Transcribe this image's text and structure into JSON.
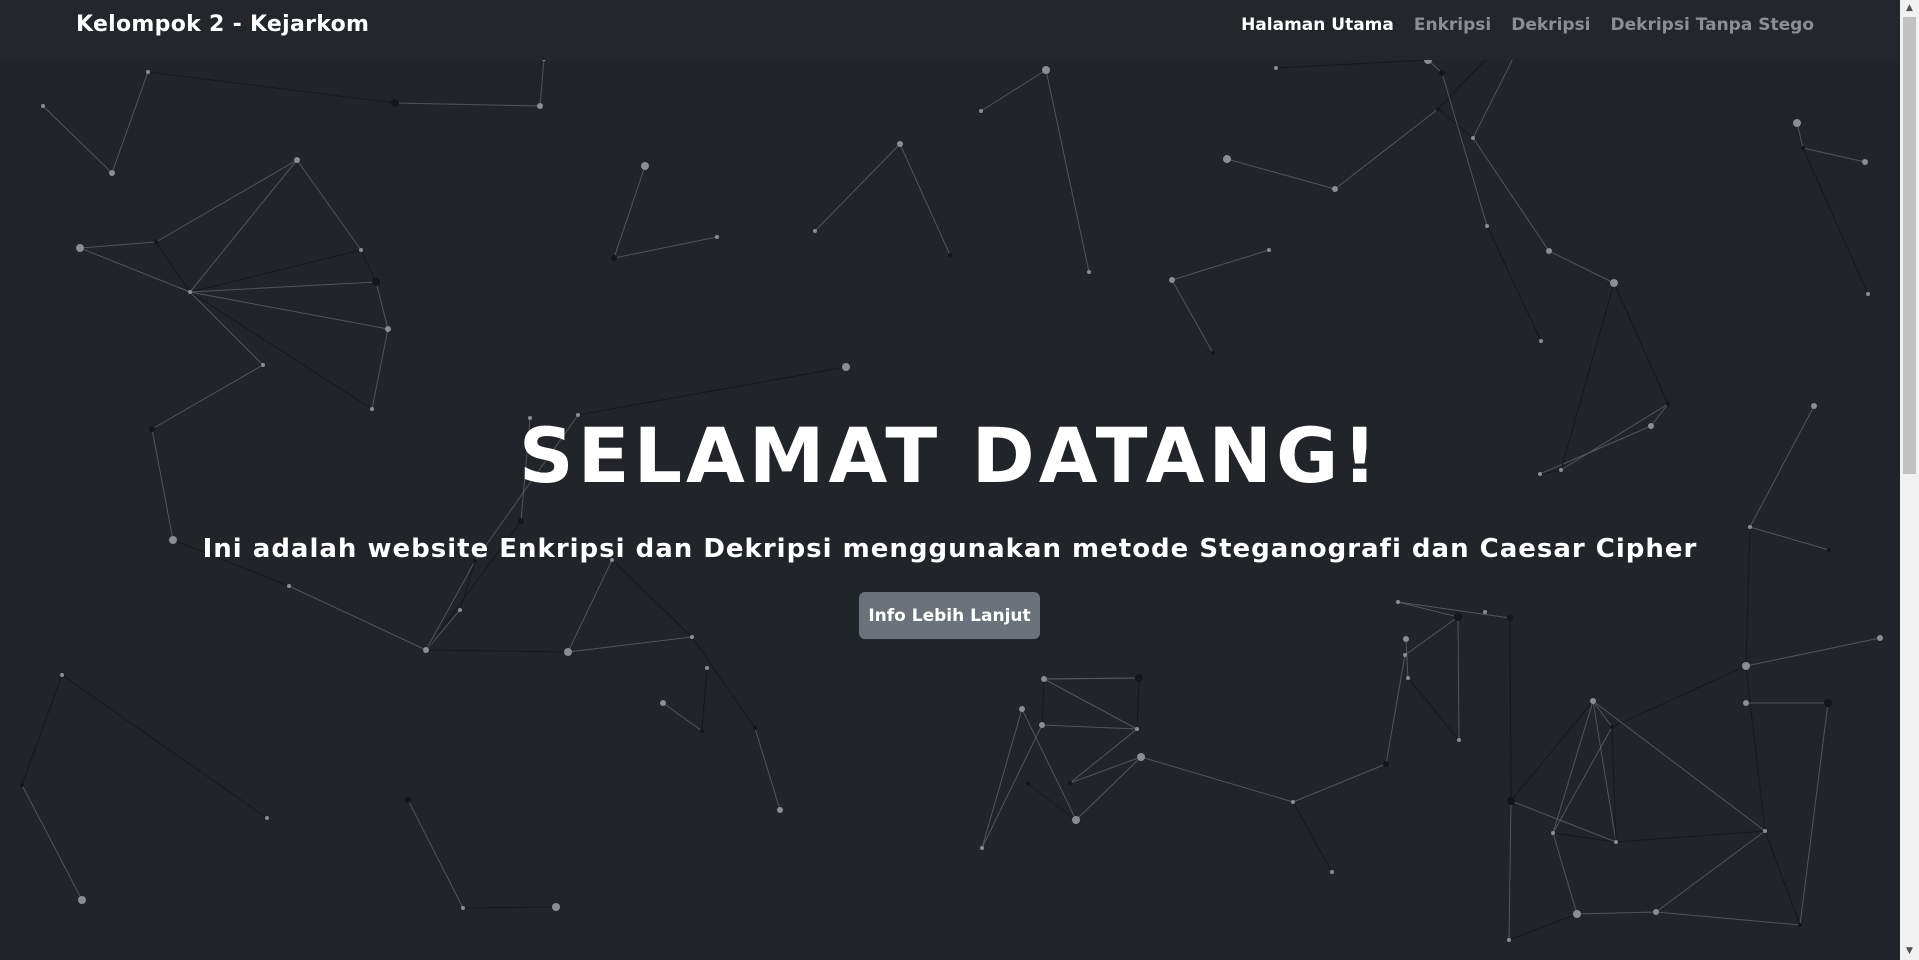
{
  "navbar": {
    "brand": "Kelompok 2 - Kejarkom",
    "links": [
      {
        "label": "Halaman Utama",
        "active": true
      },
      {
        "label": "Enkripsi",
        "active": false
      },
      {
        "label": "Dekripsi",
        "active": false
      },
      {
        "label": "Dekripsi Tanpa Stego",
        "active": false
      }
    ]
  },
  "hero": {
    "title": "SELAMAT DATANG!",
    "subtitle": "Ini adalah website Enkripsi dan Dekripsi menggunakan metode Steganografi dan Caesar Cipher",
    "button_label": "Info Lebih Lanjut"
  },
  "colors": {
    "background": "#212429",
    "navbar": "#23262b",
    "button": "#6c727b",
    "nav_active": "#ffffff",
    "nav_inactive": "#8b8f94"
  },
  "icons": {
    "scroll_up": "triangle-up-icon",
    "scroll_down": "triangle-down-icon"
  }
}
